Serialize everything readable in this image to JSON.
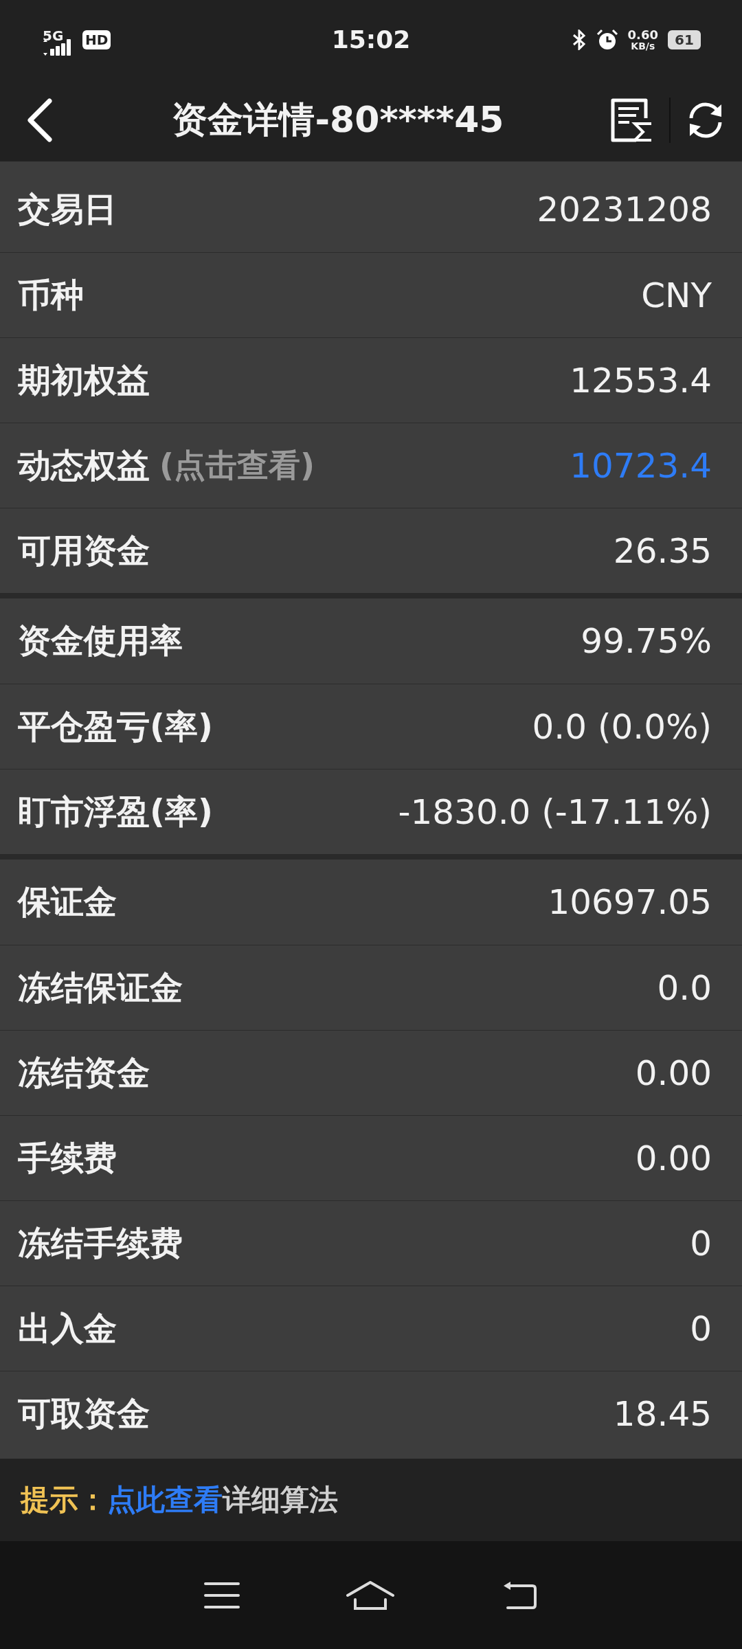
{
  "status_bar": {
    "network": "5G",
    "hd": "HD",
    "time": "15:02",
    "speed": "0.60",
    "speed_unit": "KB/s",
    "battery": "61"
  },
  "header": {
    "title": "资金详情-80****45"
  },
  "sections": [
    [
      {
        "kind": "plain",
        "label": "交易日",
        "value": "20231208"
      },
      {
        "kind": "plain",
        "label": "币种",
        "value": "CNY"
      },
      {
        "kind": "plain",
        "label": "期初权益",
        "value": "12553.4"
      },
      {
        "kind": "link",
        "label": "动态权益",
        "hint": "(点击查看)",
        "value": "10723.4"
      },
      {
        "kind": "plain",
        "label": "可用资金",
        "value": "26.35"
      }
    ],
    [
      {
        "kind": "plain",
        "label": "资金使用率",
        "value": "99.75%"
      },
      {
        "kind": "plain",
        "label": "平仓盈亏(率)",
        "value": "0.0 (0.0%)"
      },
      {
        "kind": "plain",
        "label": "盯市浮盈(率)",
        "value": "-1830.0 (-17.11%)"
      }
    ],
    [
      {
        "kind": "plain",
        "label": "保证金",
        "value": "10697.05"
      },
      {
        "kind": "plain",
        "label": "冻结保证金",
        "value": "0.0"
      },
      {
        "kind": "plain",
        "label": "冻结资金",
        "value": "0.00"
      },
      {
        "kind": "plain",
        "label": "手续费",
        "value": "0.00"
      },
      {
        "kind": "plain",
        "label": "冻结手续费",
        "value": "0"
      },
      {
        "kind": "plain",
        "label": "出入金",
        "value": "0"
      },
      {
        "kind": "plain",
        "label": "可取资金",
        "value": "18.45"
      }
    ]
  ],
  "tip": {
    "prefix": "提示：",
    "link": "点此查看",
    "text": "详细算法"
  }
}
